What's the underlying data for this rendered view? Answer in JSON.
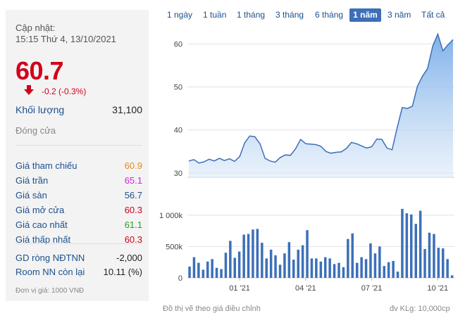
{
  "summary": {
    "update_label": "Cập nhật:",
    "update_time": "15:15 Thứ 4, 13/10/2021",
    "price": "60.7",
    "change": "-0.2 (-0.3%)",
    "volume_label": "Khối lượng",
    "volume_value": "31,100",
    "closing_label": "Đóng cửa",
    "price_stats": [
      {
        "label": "Giá tham chiếu",
        "value": "60.9",
        "color": "#e88a1a"
      },
      {
        "label": "Giá trần",
        "value": "65.1",
        "color": "#d526d5"
      },
      {
        "label": "Giá sàn",
        "value": "56.7",
        "color": "#1d4f8c"
      },
      {
        "label": "Giá mở cửa",
        "value": "60.3",
        "color": "#d0021b"
      },
      {
        "label": "Giá cao nhất",
        "value": "61.1",
        "color": "#2a9d2a"
      },
      {
        "label": "Giá thấp nhất",
        "value": "60.3",
        "color": "#d0021b"
      }
    ],
    "foreign": [
      {
        "label": "GD ròng NĐTNN",
        "value": "-2,000"
      },
      {
        "label": "Room NN còn lại",
        "value": "10.11 (%)"
      }
    ],
    "unit_note": "Đơn vị giá: 1000 VNĐ"
  },
  "range_tabs": [
    {
      "label": "1 ngày"
    },
    {
      "label": "1 tuần"
    },
    {
      "label": "1 tháng"
    },
    {
      "label": "3 tháng"
    },
    {
      "label": "6 tháng"
    },
    {
      "label": "1 năm",
      "active": true
    },
    {
      "label": "3 năm"
    },
    {
      "label": "Tất cả"
    }
  ],
  "footer": {
    "left_note": "Đồ thị vẽ theo giá điều chỉnh",
    "right_note": "đv KLg: 10,000cp"
  },
  "chart_data": [
    {
      "type": "area",
      "yticks": [
        "60",
        "50",
        "40",
        "30"
      ],
      "ytick_values": [
        60,
        50,
        40,
        30
      ],
      "ylim": [
        29,
        64
      ],
      "x_labels": [
        "01 '21",
        "04 '21",
        "07 '21",
        "10 '21"
      ],
      "x_label_index": [
        10,
        23,
        36,
        49
      ],
      "values": [
        32.8,
        33.1,
        32.3,
        32.6,
        33.2,
        32.8,
        33.4,
        32.9,
        33.3,
        32.7,
        33.8,
        37.0,
        38.6,
        38.4,
        36.8,
        33.4,
        32.8,
        32.5,
        33.6,
        34.2,
        34.1,
        35.6,
        37.8,
        36.8,
        36.7,
        36.6,
        36.2,
        35.0,
        34.6,
        34.8,
        34.9,
        35.7,
        37.1,
        36.8,
        36.3,
        35.8,
        36.1,
        37.9,
        37.8,
        35.8,
        35.4,
        40.5,
        45.2,
        45.0,
        45.5,
        50.2,
        52.5,
        54.3,
        59.5,
        62.3,
        58.4,
        59.8,
        61.0
      ],
      "color": "#3d6fb8"
    },
    {
      "type": "bar",
      "yticks": [
        "1 000k",
        "500k",
        "0"
      ],
      "ytick_values": [
        1000,
        500,
        0
      ],
      "ylim": [
        0,
        1200
      ],
      "x_labels": [
        "01 '21",
        "04 '21",
        "07 '21",
        "10 '21"
      ],
      "values": [
        180,
        330,
        240,
        130,
        260,
        300,
        160,
        140,
        400,
        590,
        320,
        420,
        690,
        700,
        770,
        780,
        560,
        310,
        450,
        360,
        210,
        390,
        570,
        290,
        450,
        520,
        760,
        310,
        310,
        260,
        330,
        310,
        220,
        240,
        170,
        620,
        710,
        240,
        330,
        300,
        550,
        390,
        500,
        190,
        250,
        270,
        100,
        1100,
        1030,
        1010,
        860,
        1070,
        460,
        720,
        700,
        480,
        470,
        300,
        40
      ]
    }
  ]
}
